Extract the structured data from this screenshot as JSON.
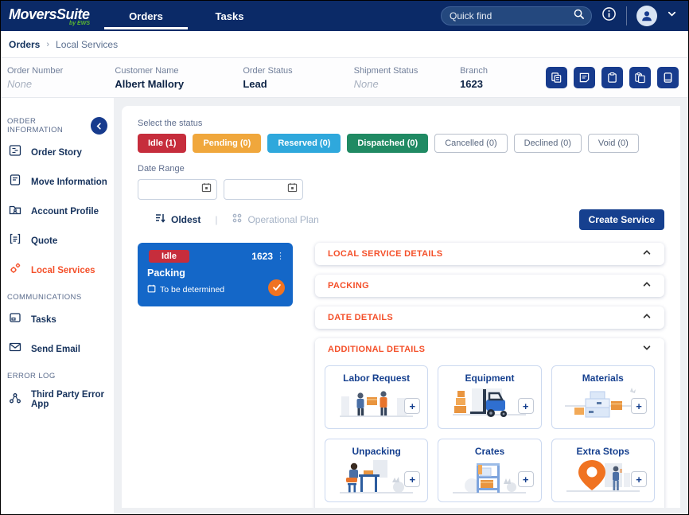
{
  "colors": {
    "navbar_navy": "#0B2A67",
    "button_navy": "#16408F",
    "icon_button_navy": "#173B8D",
    "accent_orange": "#F4502A",
    "card_blue": "#1467C8",
    "idle_red": "#C62D3C",
    "pending_orange": "#F0A73C",
    "reserved_cyan": "#2FA8DC",
    "dispatched_green": "#208A63",
    "check_orange": "#F07321",
    "logo_green": "#5CB830"
  },
  "topbar": {
    "logo": "MoversSuite",
    "logo_sub": "by EWS",
    "tabs": [
      {
        "label": "Orders",
        "active": true
      },
      {
        "label": "Tasks",
        "active": false
      }
    ],
    "search_placeholder": "Quick find"
  },
  "breadcrumb": {
    "root": "Orders",
    "separator": "›",
    "current": "Local Services"
  },
  "order_bar": {
    "fields": [
      {
        "label": "Order Number",
        "value": "None"
      },
      {
        "label": "Customer Name",
        "value": "Albert Mallory"
      },
      {
        "label": "Order Status",
        "value": "Lead"
      },
      {
        "label": "Shipment Status",
        "value": "None"
      },
      {
        "label": "Branch",
        "value": "1623"
      }
    ]
  },
  "sidebar": {
    "sections": [
      {
        "title": "ORDER INFORMATION",
        "items": [
          {
            "label": "Order Story"
          },
          {
            "label": "Move Information"
          },
          {
            "label": "Account Profile"
          },
          {
            "label": "Quote"
          },
          {
            "label": "Local Services"
          }
        ]
      },
      {
        "title": "COMMUNICATIONS",
        "items": [
          {
            "label": "Tasks"
          },
          {
            "label": "Send Email"
          }
        ]
      },
      {
        "title": "ERROR LOG",
        "items": [
          {
            "label": "Third Party Error App"
          }
        ]
      }
    ]
  },
  "filters": {
    "select_label": "Select the status",
    "statuses": [
      {
        "label": "Idle (1)",
        "color": "#C62D3C",
        "filled": true
      },
      {
        "label": "Pending (0)",
        "color": "#F0A73C",
        "filled": true
      },
      {
        "label": "Reserved (0)",
        "color": "#2FA8DC",
        "filled": true
      },
      {
        "label": "Dispatched (0)",
        "color": "#208A63",
        "filled": true
      },
      {
        "label": "Cancelled (0)",
        "filled": false
      },
      {
        "label": "Declined (0)",
        "filled": false
      },
      {
        "label": "Void (0)",
        "filled": false
      }
    ],
    "date_range_label": "Date Range",
    "date_from_value": "",
    "date_to_value": "",
    "sort_label": "Oldest",
    "divider": "|",
    "operational_plan_label": "Operational Plan",
    "create_service_label": "Create Service"
  },
  "service_card": {
    "status_badge": "Idle",
    "branch": "1623",
    "kebab": "⋮",
    "title": "Packing",
    "date_text": "To be determined"
  },
  "details": {
    "accordions": [
      {
        "label": "LOCAL SERVICE DETAILS",
        "expanded": false
      },
      {
        "label": "PACKING",
        "expanded": false
      },
      {
        "label": "DATE DETAILS",
        "expanded": false
      },
      {
        "label": "ADDITIONAL DETAILS",
        "expanded": true
      }
    ],
    "tiles": [
      {
        "label": "Labor Request"
      },
      {
        "label": "Equipment"
      },
      {
        "label": "Materials"
      },
      {
        "label": "Unpacking"
      },
      {
        "label": "Crates"
      },
      {
        "label": "Extra Stops"
      }
    ],
    "add_button": "+"
  }
}
